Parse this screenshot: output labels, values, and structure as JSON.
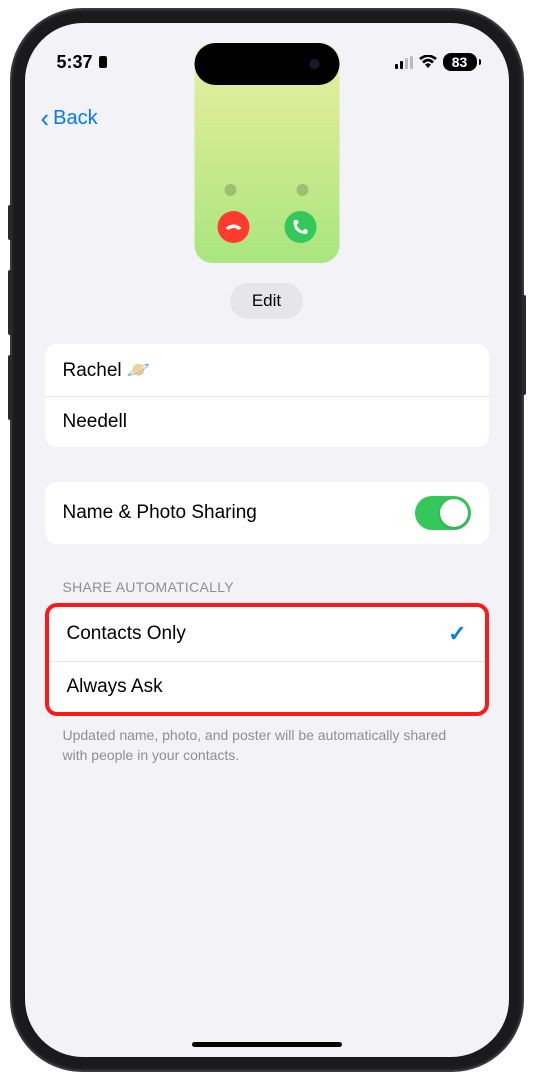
{
  "status": {
    "time": "5:37",
    "battery": "83"
  },
  "nav": {
    "back_label": "Back"
  },
  "edit_label": "Edit",
  "name": {
    "first": "Rachel 🪐",
    "last": "Needell"
  },
  "sharing": {
    "label": "Name & Photo Sharing",
    "enabled": true
  },
  "share_auto": {
    "header": "SHARE AUTOMATICALLY",
    "options": [
      {
        "label": "Contacts Only",
        "selected": true
      },
      {
        "label": "Always Ask",
        "selected": false
      }
    ],
    "footer": "Updated name, photo, and poster will be automatically shared with people in your contacts."
  }
}
